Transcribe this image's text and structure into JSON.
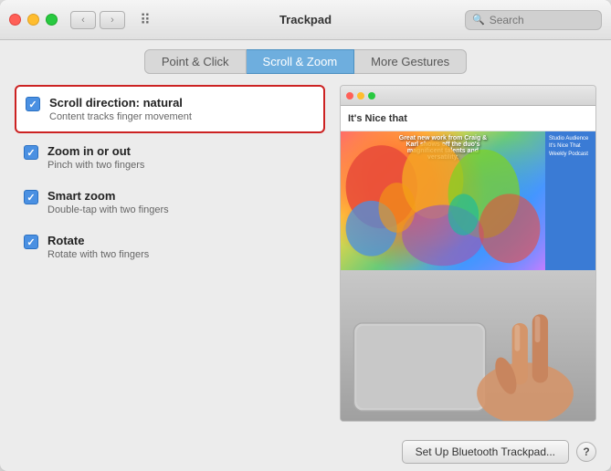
{
  "titlebar": {
    "title": "Trackpad",
    "search_placeholder": "Search"
  },
  "tabs": [
    {
      "id": "point-click",
      "label": "Point & Click",
      "active": false
    },
    {
      "id": "scroll-zoom",
      "label": "Scroll & Zoom",
      "active": true
    },
    {
      "id": "more-gestures",
      "label": "More Gestures",
      "active": false
    }
  ],
  "settings": [
    {
      "id": "scroll-direction",
      "title": "Scroll direction: natural",
      "desc": "Content tracks finger movement",
      "checked": true,
      "highlighted": true
    },
    {
      "id": "zoom-in-out",
      "title": "Zoom in or out",
      "desc": "Pinch with two fingers",
      "checked": true,
      "highlighted": false
    },
    {
      "id": "smart-zoom",
      "title": "Smart zoom",
      "desc": "Double-tap with two fingers",
      "checked": true,
      "highlighted": false
    },
    {
      "id": "rotate",
      "title": "Rotate",
      "desc": "Rotate with two fingers",
      "checked": true,
      "highlighted": false
    }
  ],
  "browser_preview": {
    "site_title": "It's Nice that",
    "article_text": "Great new work from Craig & Karl shows off the duo's magnificent talents and versatility.",
    "sidebar_text": "Studio Audience It's Nice That Weekly Podcast"
  },
  "footer": {
    "bluetooth_btn": "Set Up Bluetooth Trackpad...",
    "help_btn": "?"
  }
}
